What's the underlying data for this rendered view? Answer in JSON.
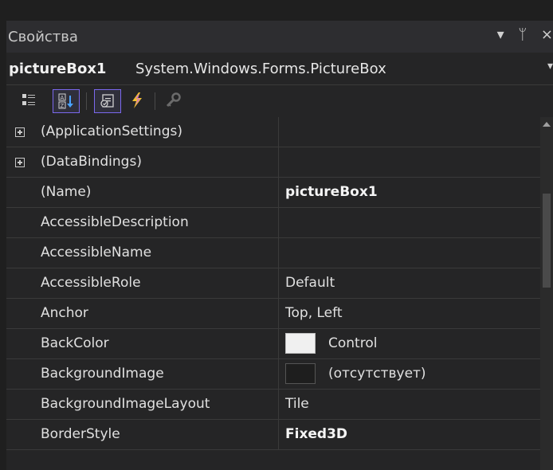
{
  "window": {
    "title": "Свойства",
    "controls": [
      {
        "name": "dropdown-arrow-icon",
        "glyph": "▾"
      },
      {
        "name": "pin-icon",
        "glyph": "ᛘ"
      },
      {
        "name": "close-icon",
        "glyph": "×"
      }
    ]
  },
  "object_selector": {
    "name": "pictureBox1",
    "type": "System.Windows.Forms.PictureBox"
  },
  "toolbar": {
    "buttons": [
      {
        "name": "categorized-view-icon",
        "active": false
      },
      {
        "name": "alphabetical-sort-icon",
        "active": true
      },
      {
        "name": "properties-icon",
        "active": true
      },
      {
        "name": "events-icon",
        "active": false
      },
      {
        "name": "property-pages-icon",
        "active": false
      }
    ]
  },
  "properties": [
    {
      "name": "(ApplicationSettings)",
      "value": "",
      "expandable": true
    },
    {
      "name": "(DataBindings)",
      "value": "",
      "expandable": true
    },
    {
      "name": "(Name)",
      "value": "pictureBox1",
      "bold": true
    },
    {
      "name": "AccessibleDescription",
      "value": ""
    },
    {
      "name": "AccessibleName",
      "value": ""
    },
    {
      "name": "AccessibleRole",
      "value": "Default"
    },
    {
      "name": "Anchor",
      "value": "Top, Left"
    },
    {
      "name": "BackColor",
      "value": "Control",
      "swatch": "light"
    },
    {
      "name": "BackgroundImage",
      "value": "(отсутствует)",
      "swatch": "dark"
    },
    {
      "name": "BackgroundImageLayout",
      "value": "Tile"
    },
    {
      "name": "BorderStyle",
      "value": "Fixed3D",
      "bold": true
    }
  ],
  "colors": {
    "panel": "#252526",
    "titlebar": "#2d2d30",
    "active_button_border": "#7b68ee",
    "swatch_light": "#f0f0f0",
    "swatch_dark": "#1e1e1e"
  }
}
